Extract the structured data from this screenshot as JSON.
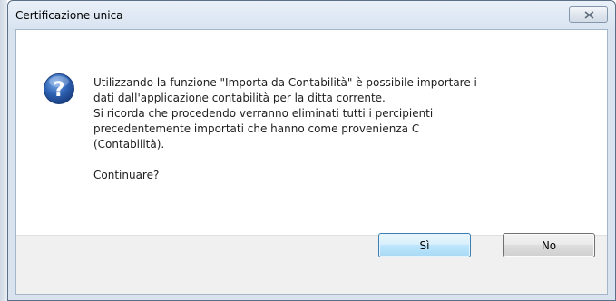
{
  "dialog": {
    "title": "Certificazione unica",
    "icon": "question-icon",
    "message_lines": [
      "Utilizzando la funzione \"Importa da Contabilità\" è possibile importare i",
      "dati dall'applicazione contabilità per la ditta corrente.",
      "Si ricorda che procedendo verranno eliminati tutti i percipienti",
      "precedentemente importati che hanno come provenienza C",
      "(Contabilità)."
    ],
    "prompt": "Continuare?",
    "buttons": {
      "yes_label": "Sì",
      "no_label": "No"
    }
  },
  "colors": {
    "icon_blue": "#2f64b5",
    "default_button_border": "#3c7fb1"
  }
}
